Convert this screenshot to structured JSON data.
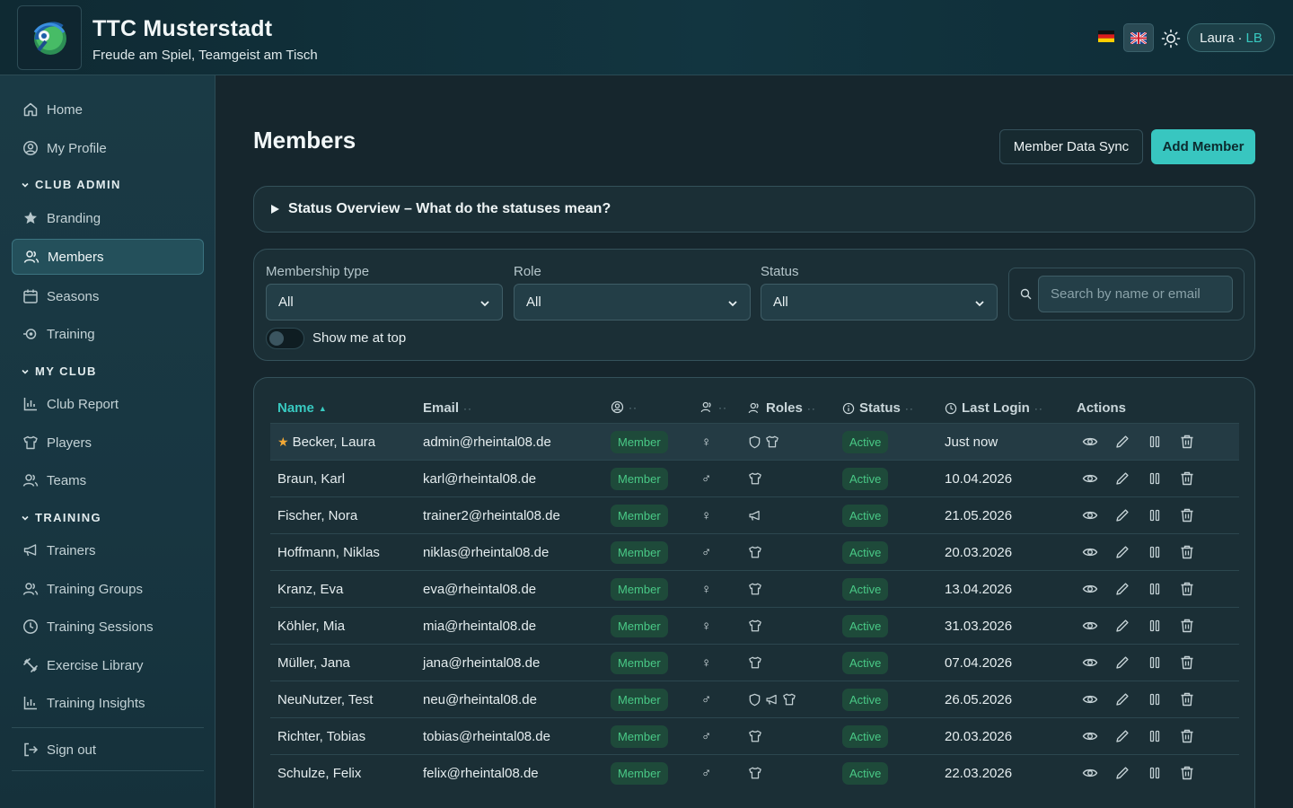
{
  "header": {
    "club_name": "TTC Musterstadt",
    "club_tagline": "Freude am Spiel, Teamgeist am Tisch",
    "user_name": "Laura",
    "user_separator": "·",
    "user_initials": "LB"
  },
  "sidebar": {
    "items": [
      {
        "label": "Home",
        "icon": "home-icon"
      },
      {
        "label": "My Profile",
        "icon": "user-circle-icon"
      }
    ],
    "sections": [
      {
        "title": "CLUB ADMIN",
        "items": [
          {
            "label": "Branding",
            "icon": "star-icon"
          },
          {
            "label": "Members",
            "icon": "users-icon",
            "active": true
          },
          {
            "label": "Seasons",
            "icon": "calendar-icon"
          },
          {
            "label": "Training",
            "icon": "training-icon"
          }
        ]
      },
      {
        "title": "MY CLUB",
        "items": [
          {
            "label": "Club Report",
            "icon": "bar-chart-icon"
          },
          {
            "label": "Players",
            "icon": "shirt-icon"
          },
          {
            "label": "Teams",
            "icon": "users-icon"
          }
        ]
      },
      {
        "title": "TRAINING",
        "items": [
          {
            "label": "Trainers",
            "icon": "megaphone-icon"
          },
          {
            "label": "Training Groups",
            "icon": "users-icon"
          },
          {
            "label": "Training Sessions",
            "icon": "clock-icon"
          },
          {
            "label": "Exercise Library",
            "icon": "dumbbell-icon"
          },
          {
            "label": "Training Insights",
            "icon": "bar-chart-icon"
          }
        ]
      }
    ],
    "sign_out": "Sign out"
  },
  "main": {
    "title": "Members",
    "sync_button": "Member Data Sync",
    "add_button": "Add Member",
    "status_overview": "Status Overview – What do the statuses mean?",
    "filters": {
      "membership_label": "Membership type",
      "membership_value": "All",
      "role_label": "Role",
      "role_value": "All",
      "status_label": "Status",
      "status_value": "All",
      "search_placeholder": "Search by name or email",
      "show_me_label": "Show me at top"
    },
    "table": {
      "columns": {
        "name": "Name",
        "sort_indicator": "▲",
        "email": "Email",
        "roles": "Roles",
        "status": "Status",
        "last_login": "Last Login",
        "actions": "Actions",
        "dots": "··"
      },
      "rows": [
        {
          "name": "Becker, Laura",
          "email": "admin@rheintal08.de",
          "membership": "Member",
          "gender": "♀",
          "roles": [
            "shield",
            "shirt"
          ],
          "status": "Active",
          "last_login": "Just now",
          "me": true
        },
        {
          "name": "Braun, Karl",
          "email": "karl@rheintal08.de",
          "membership": "Member",
          "gender": "♂",
          "roles": [
            "shirt"
          ],
          "status": "Active",
          "last_login": "10.04.2026"
        },
        {
          "name": "Fischer, Nora",
          "email": "trainer2@rheintal08.de",
          "membership": "Member",
          "gender": "♀",
          "roles": [
            "megaphone"
          ],
          "status": "Active",
          "last_login": "21.05.2026"
        },
        {
          "name": "Hoffmann, Niklas",
          "email": "niklas@rheintal08.de",
          "membership": "Member",
          "gender": "♂",
          "roles": [
            "shirt"
          ],
          "status": "Active",
          "last_login": "20.03.2026"
        },
        {
          "name": "Kranz, Eva",
          "email": "eva@rheintal08.de",
          "membership": "Member",
          "gender": "♀",
          "roles": [
            "shirt"
          ],
          "status": "Active",
          "last_login": "13.04.2026"
        },
        {
          "name": "Köhler, Mia",
          "email": "mia@rheintal08.de",
          "membership": "Member",
          "gender": "♀",
          "roles": [
            "shirt"
          ],
          "status": "Active",
          "last_login": "31.03.2026"
        },
        {
          "name": "Müller, Jana",
          "email": "jana@rheintal08.de",
          "membership": "Member",
          "gender": "♀",
          "roles": [
            "shirt"
          ],
          "status": "Active",
          "last_login": "07.04.2026"
        },
        {
          "name": "NeuNutzer, Test",
          "email": "neu@rheintal08.de",
          "membership": "Member",
          "gender": "♂",
          "roles": [
            "shield",
            "megaphone",
            "shirt"
          ],
          "status": "Active",
          "last_login": "26.05.2026"
        },
        {
          "name": "Richter, Tobias",
          "email": "tobias@rheintal08.de",
          "membership": "Member",
          "gender": "♂",
          "roles": [
            "shirt"
          ],
          "status": "Active",
          "last_login": "20.03.2026"
        },
        {
          "name": "Schulze, Felix",
          "email": "felix@rheintal08.de",
          "membership": "Member",
          "gender": "♂",
          "roles": [
            "shirt"
          ],
          "status": "Active",
          "last_login": "22.03.2026"
        }
      ]
    }
  },
  "colors": {
    "accent": "#38c6c0",
    "badge_text": "#49c986",
    "badge_bg": "#1e4a3a",
    "background": "#16262d"
  }
}
